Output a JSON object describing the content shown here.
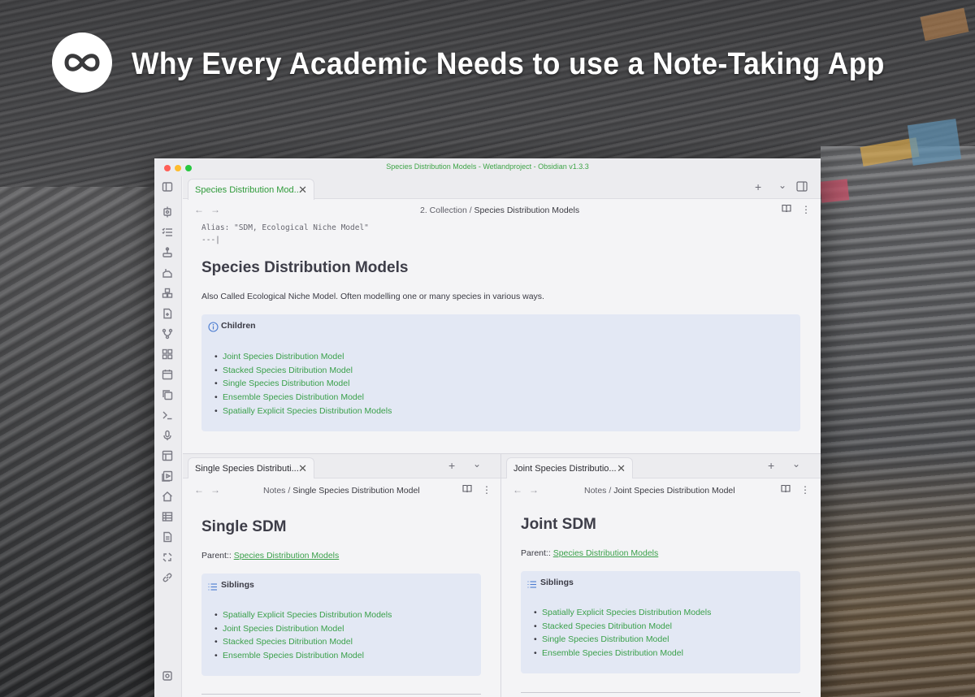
{
  "banner": {
    "headline": "Why Every Academic Needs to use a Note-Taking App",
    "logo_icon": "infinity-icon"
  },
  "window": {
    "title": "Species Distribution Models - Wetlandproject - Obsidian v1.3.3",
    "traffic_lights": [
      "#ff5f57",
      "#febc2e",
      "#28c840"
    ]
  },
  "ribbon": {
    "icons": [
      "graph-core-icon",
      "checklist-icon",
      "stamp-icon",
      "hand-icon",
      "cubes-icon",
      "file-plus-icon",
      "git-branch-icon",
      "dashboard-icon",
      "calendar-icon",
      "copy-icon",
      "terminal-icon",
      "mic-icon",
      "layout-icon",
      "slides-icon",
      "home-icon",
      "table-icon",
      "document-icon",
      "broken-link-icon",
      "link-icon",
      "vault-icon"
    ]
  },
  "top_pane": {
    "tab_label": "Species Distribution Mod...",
    "breadcrumb_folder": "2. Collection",
    "breadcrumb_sep": "/",
    "breadcrumb_note": "Species Distribution Models",
    "frontmatter_line": "Alias: \"SDM, Ecological Niche Model\"",
    "frontmatter_end": "---|",
    "heading": "Species Distribution Models",
    "description": "Also Called Ecological Niche Model. Often modelling one or many species in various ways.",
    "callout_title": "Children",
    "callout_items": [
      "Joint Species Distribution Model",
      "Stacked Species Ditribution Model",
      "Single Species Distribution Model",
      "Ensemble Species Distribution Model",
      "Spatially Explicit Species Distribution Models"
    ]
  },
  "left_pane": {
    "tab_label": "Single Species Distributi...",
    "breadcrumb_folder": "Notes",
    "breadcrumb_sep": "/",
    "breadcrumb_note": "Single Species Distribution Model",
    "heading": "Single SDM",
    "parent_label": "Parent::",
    "parent_link": "Species Distribution Models",
    "callout_title": "Siblings",
    "callout_items": [
      "Spatially Explicit Species Distribution Models",
      "Joint Species Distribution Model",
      "Stacked Species Ditribution Model",
      "Ensemble Species Distribution Model"
    ]
  },
  "right_pane": {
    "tab_label": "Joint Species Distributio...",
    "breadcrumb_folder": "Notes",
    "breadcrumb_sep": "/",
    "breadcrumb_note": "Joint Species Distribution Model",
    "heading": "Joint SDM",
    "parent_label": "Parent::",
    "parent_link": "Species Distribution Models",
    "callout_title": "Siblings",
    "callout_items": [
      "Spatially Explicit Species Distribution Models",
      "Stacked Species Ditribution Model",
      "Single Species Distribution Model",
      "Ensemble Species Distribution Model"
    ]
  },
  "colors": {
    "accent_green": "#3aa04a",
    "callout_bg": "#e3e8f4"
  }
}
